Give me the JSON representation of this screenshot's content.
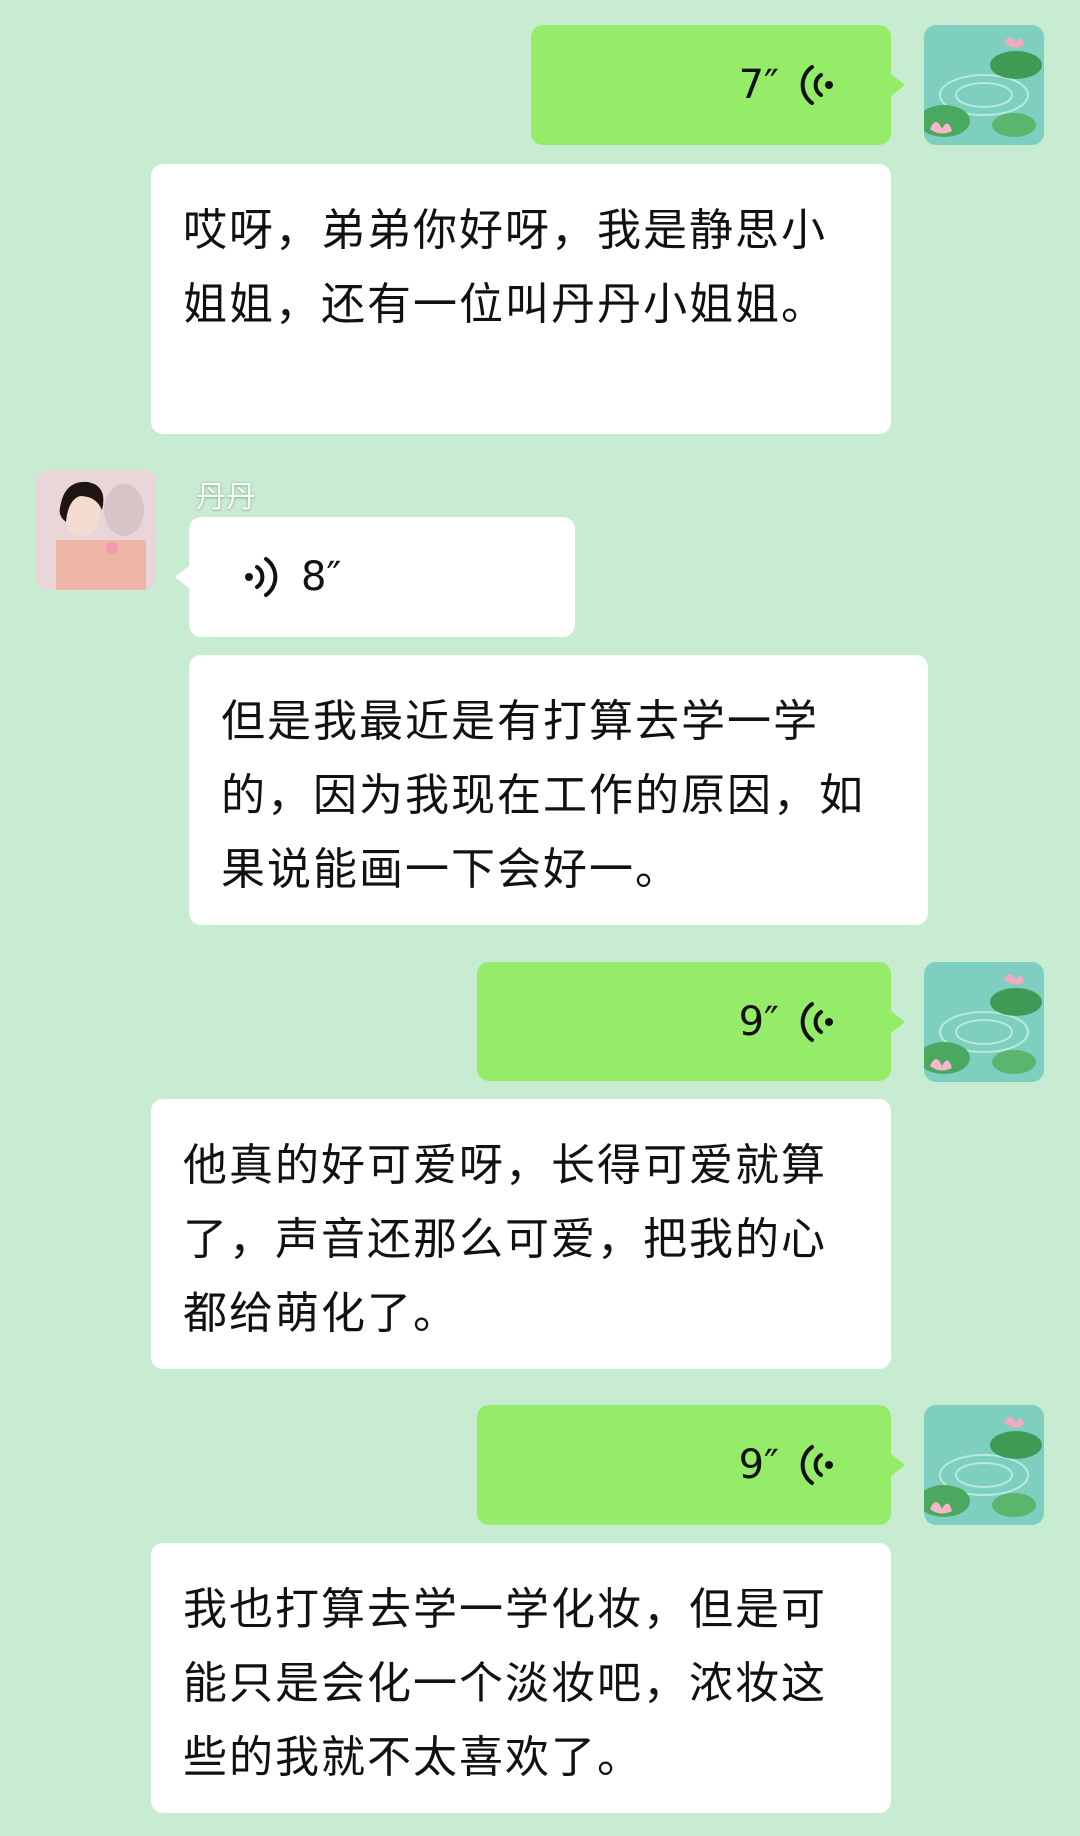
{
  "contact": {
    "name": "丹丹"
  },
  "messages": [
    {
      "type": "voice",
      "from": "me",
      "duration": "7″"
    },
    {
      "type": "text",
      "text": "哎呀，弟弟你好呀，我是静思小姐姐，还有一位叫丹丹小姐姐。"
    },
    {
      "type": "voice",
      "from": "other",
      "sender": "丹丹",
      "duration": "8″"
    },
    {
      "type": "text",
      "text": "但是我最近是有打算去学一学的，因为我现在工作的原因，如果说能画一下会好一。"
    },
    {
      "type": "voice",
      "from": "me",
      "duration": "9″"
    },
    {
      "type": "text",
      "text": "他真的好可爱呀，长得可爱就算了，声音还那么可爱，把我的心都给萌化了。"
    },
    {
      "type": "voice",
      "from": "me",
      "duration": "9″"
    },
    {
      "type": "text",
      "text": "我也打算去学一学化妆，但是可能只是会化一个淡妆吧，浓妆这些的我就不太喜欢了。"
    }
  ],
  "icons": {
    "voice_outgoing": "voice-wave-icon",
    "voice_incoming": "voice-wave-icon",
    "my_avatar": "lotus-pond-avatar",
    "contact_avatar": "woman-portrait-avatar"
  },
  "colors": {
    "background": "#c7ecd2",
    "my_bubble": "#95ec69",
    "other_bubble": "#ffffff"
  }
}
